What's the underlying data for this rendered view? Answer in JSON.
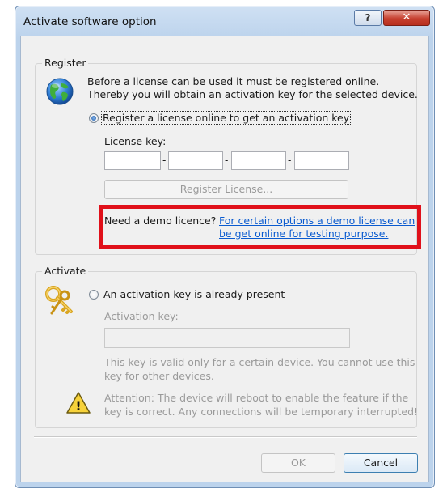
{
  "window": {
    "title": "Activate software option",
    "help_glyph": "?",
    "close_glyph": "✕"
  },
  "register": {
    "group_label": "Register",
    "description_line1": "Before a license can be used it must be registered online.",
    "description_line2": "Thereby you will obtain an activation key for the selected device.",
    "radio_label": "Register a license online to get an activation key",
    "license_key_label": "License key:",
    "dash": "-",
    "register_button": "Register License...",
    "demo_question": "Need a demo licence?",
    "demo_link_line1": "For certain options a demo license can",
    "demo_link_line2": "be get online for testing purpose."
  },
  "activate": {
    "group_label": "Activate",
    "radio_label": "An activation key is already present",
    "activation_key_label": "Activation key:",
    "info_line1": "This key is valid only for a certain device. You cannot use this",
    "info_line2": "key for other devices.",
    "warning_line1": "Attention: The device will reboot to enable the feature if the",
    "warning_line2": "key is correct. Any connections will be temporary interrupted!"
  },
  "buttons": {
    "ok": "OK",
    "cancel": "Cancel"
  },
  "icons": {
    "register": "globe-icon",
    "activate": "keys-icon",
    "warning": "warning-icon",
    "warning_glyph": "!"
  }
}
